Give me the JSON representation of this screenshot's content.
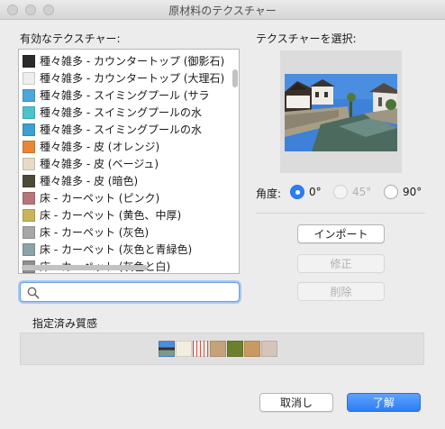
{
  "window": {
    "title": "原材料のテクスチャー"
  },
  "texture_list": {
    "heading": "有効なテクスチャー:",
    "items": [
      {
        "label": "種々雑多 - カウンタートップ (御影石)",
        "color": "#2a2a2a"
      },
      {
        "label": "種々雑多 - カウンタートップ (大理石)",
        "color": "#eeeeec"
      },
      {
        "label": "種々雑多 - スイミングプール (サラ",
        "color": "#4fa6dd"
      },
      {
        "label": "種々雑多 - スイミングプールの水",
        "color": "#4cc3c9"
      },
      {
        "label": "種々雑多 - スイミングプールの水",
        "color": "#3f9fd0"
      },
      {
        "label": "種々雑多 - 皮 (オレンジ)",
        "color": "#e8873a"
      },
      {
        "label": "種々雑多 - 皮 (ベージュ)",
        "color": "#e6dcc6"
      },
      {
        "label": "種々雑多 - 皮 (暗色)",
        "color": "#4e4a3a"
      },
      {
        "label": "床 - カーペット (ピンク)",
        "color": "#b4767a"
      },
      {
        "label": "床 - カーペット (黄色、中厚)",
        "color": "#c9b45a"
      },
      {
        "label": "床 - カーペット (灰色)",
        "color": "#a7a7a7"
      },
      {
        "label": "床 - カーペット (灰色と青緑色)",
        "color": "#8aa3a7"
      },
      {
        "label": "床 - カーペット (灰色と白)",
        "color": "#8f8f8f"
      }
    ]
  },
  "search": {
    "placeholder": "",
    "value": ""
  },
  "select_texture": {
    "heading": "テクスチャーを選択:"
  },
  "angle": {
    "label": "角度:",
    "options": [
      {
        "label": "0°",
        "selected": true,
        "enabled": true
      },
      {
        "label": "45°",
        "selected": false,
        "enabled": false
      },
      {
        "label": "90°",
        "selected": false,
        "enabled": true
      }
    ]
  },
  "actions": {
    "import_label": "インポート",
    "modify_label": "修正",
    "delete_label": "削除"
  },
  "applied": {
    "heading": "指定済み質感",
    "swatches": [
      "photo",
      "#f3ece0",
      "stripes",
      "#c4a27a",
      "#6b7f2e",
      "#c79a62",
      "#d7c4b8"
    ]
  },
  "footer": {
    "cancel_label": "取消し",
    "ok_label": "了解"
  },
  "colors": {
    "accent": "#2e7cf6",
    "focus": "#6a9ee6"
  }
}
